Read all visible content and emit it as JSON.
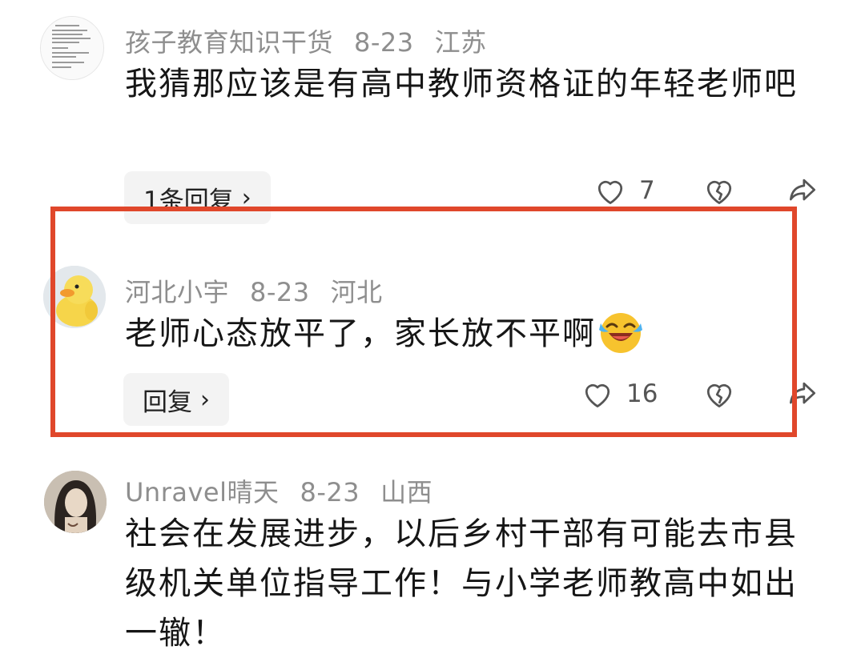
{
  "comments": [
    {
      "username": "孩子教育知识干货",
      "date": "8-23",
      "location": "江苏",
      "text": "我猜那应该是有高中教师资格证的年轻老师吧",
      "reply_label": "1条回复",
      "likes": "7"
    },
    {
      "username": "河北小宇",
      "date": "8-23",
      "location": "河北",
      "text": "老师心态放平了，家长放不平啊",
      "emoji": "laugh-cry-emoji",
      "reply_label": "回复",
      "likes": "16"
    },
    {
      "username": "Unravel晴天",
      "date": "8-23",
      "location": "山西",
      "text": "社会在发展进步，以后乡村干部有可能去市县级机关单位指导工作！与小学老师教高中如出一辙！"
    }
  ],
  "icons": {
    "like": "heart-icon",
    "dislike": "broken-heart-icon",
    "share": "share-arrow-icon",
    "chevron": "chevron-right-icon"
  },
  "colors": {
    "highlight_border": "#e0472b",
    "meta_text": "#8e8e8e",
    "reply_bg": "#f3f3f3"
  }
}
